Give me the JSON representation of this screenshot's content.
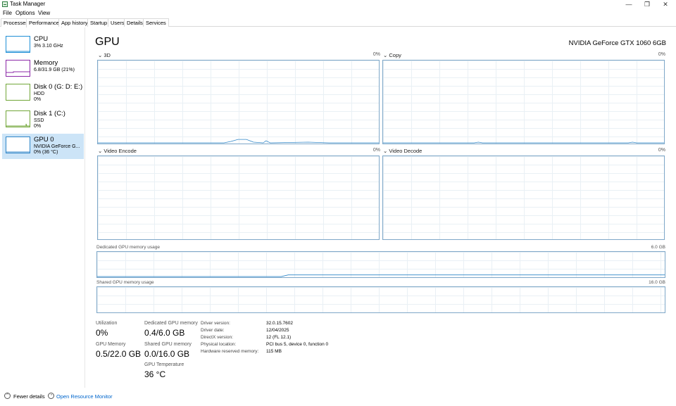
{
  "window": {
    "title": "Task Manager",
    "minimize": "—",
    "restore": "❐",
    "close": "✕"
  },
  "menu": [
    "File",
    "Options",
    "View"
  ],
  "tabs": [
    "Processes",
    "Performance",
    "App history",
    "Startup",
    "Users",
    "Details",
    "Services"
  ],
  "sidebar": [
    {
      "name": "CPU",
      "line1": "3% 3.10 GHz",
      "line2": ""
    },
    {
      "name": "Memory",
      "line1": "6.8/31.9 GB (21%)",
      "line2": ""
    },
    {
      "name": "Disk 0 (G: D: E:)",
      "line1": "HDD",
      "line2": "0%"
    },
    {
      "name": "Disk 1 (C:)",
      "line1": "SSD",
      "line2": "0%"
    },
    {
      "name": "GPU 0",
      "line1": "NVIDIA GeForce G...",
      "line2": "0% (36 °C)"
    }
  ],
  "colors": {
    "cpu": "#1f8fd6",
    "memory": "#8b27a7",
    "disk": "#71a637",
    "gpu": "#2f86c8",
    "graph_border": "#7ea7c8"
  },
  "header": {
    "title": "GPU",
    "model": "NVIDIA GeForce GTX 1060 6GB"
  },
  "graphs": {
    "g3d": {
      "label": "3D",
      "pct": "0%"
    },
    "copy": {
      "label": "Copy",
      "pct": "0%"
    },
    "encode": {
      "label": "Video Encode",
      "pct": "0%"
    },
    "decode": {
      "label": "Video Decode",
      "pct": "0%"
    },
    "dedicated": {
      "label": "Dedicated GPU memory usage",
      "max": "6.0 GB"
    },
    "shared": {
      "label": "Shared GPU memory usage",
      "max": "16.0 GB"
    }
  },
  "stats": {
    "utilization": {
      "label": "Utilization",
      "value": "0%"
    },
    "gpu_memory": {
      "label": "GPU Memory",
      "value": "0.5/22.0 GB"
    },
    "dedicated": {
      "label": "Dedicated GPU memory",
      "value": "0.4/6.0 GB"
    },
    "shared": {
      "label": "Shared GPU memory",
      "value": "0.0/16.0 GB"
    },
    "temperature": {
      "label": "GPU Temperature",
      "value": "36 °C"
    }
  },
  "info": [
    {
      "label": "Driver version:",
      "value": "32.0.15.7602"
    },
    {
      "label": "Driver date:",
      "value": "12/04/2025"
    },
    {
      "label": "DirectX version:",
      "value": "12 (FL 12.1)"
    },
    {
      "label": "Physical location:",
      "value": "PCI bus 5, device 0, function 0"
    },
    {
      "label": "Hardware reserved memory:",
      "value": "115 MB"
    }
  ],
  "footer": {
    "fewer_details": "Fewer details",
    "resource_monitor": "Open Resource Monitor"
  }
}
